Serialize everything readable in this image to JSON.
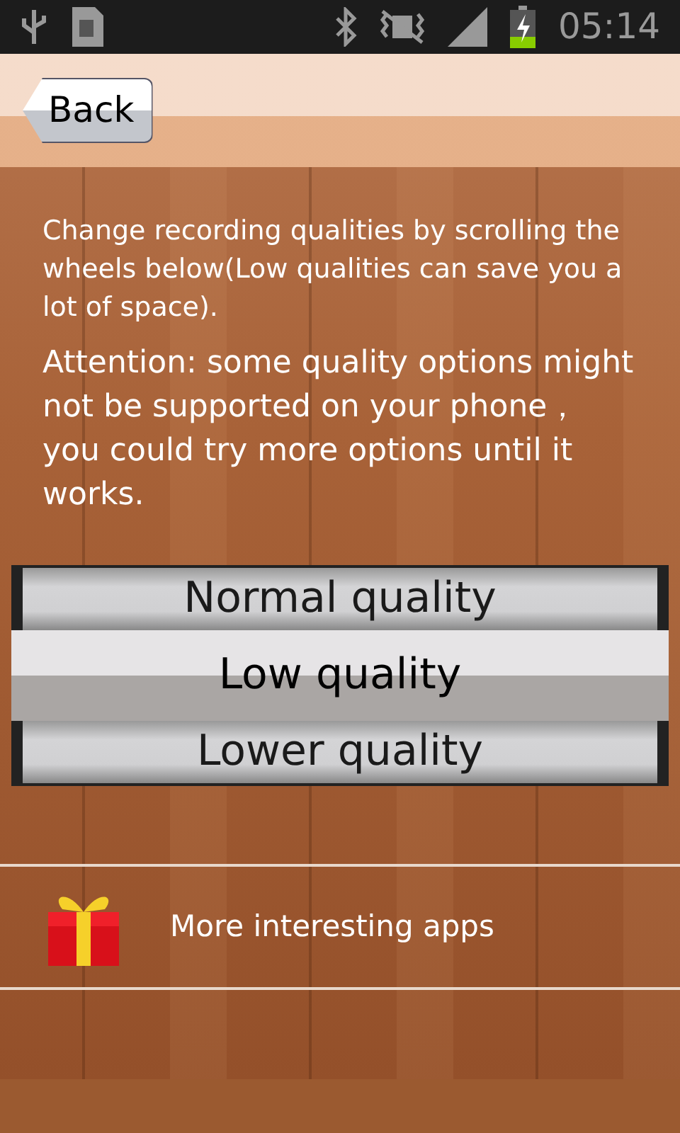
{
  "status_bar": {
    "time": "05:14"
  },
  "header": {
    "back_button": "Back"
  },
  "description": "Change recording qualities by scrolling the wheels below(Low qualities can save you a lot of space).",
  "attention": "Attention: some quality options might not be supported on your phone， you could try more options until it works.",
  "quality_wheel": [
    {
      "label": "Normal quality",
      "selected": false
    },
    {
      "label": "Low quality",
      "selected": true
    },
    {
      "label": "Lower quality",
      "selected": false
    }
  ],
  "more_apps": {
    "label": "More interesting apps"
  }
}
